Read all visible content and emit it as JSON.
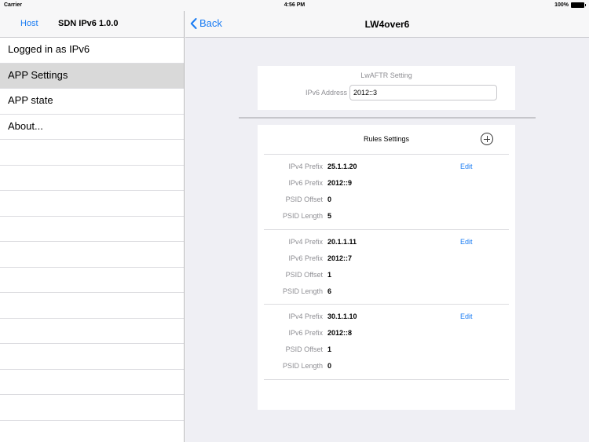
{
  "status_bar": {
    "carrier": "Carrier",
    "time": "4:56 PM",
    "battery": "100%"
  },
  "master": {
    "host_label": "Host",
    "title": "SDN IPv6 1.0.0",
    "items": [
      {
        "label": "Logged in as IPv6"
      },
      {
        "label": "APP Settings",
        "selected": true
      },
      {
        "label": "APP state"
      },
      {
        "label": "About..."
      }
    ]
  },
  "detail": {
    "back_label": "Back",
    "title": "LW4over6",
    "lwaftr": {
      "title": "LwAFTR Setting",
      "ipv6_label": "IPv6 Address",
      "ipv6_value": "2012::3"
    },
    "rules": {
      "title": "Rules Settings",
      "edit_label": "Edit",
      "labels": {
        "ipv4_prefix": "IPv4 Prefix",
        "ipv6_prefix": "IPv6 Prefix",
        "psid_offset": "PSID Offset",
        "psid_length": "PSID Length"
      },
      "items": [
        {
          "ipv4_prefix": "25.1.1.20",
          "ipv6_prefix": "2012::9",
          "psid_offset": "0",
          "psid_length": "5"
        },
        {
          "ipv4_prefix": "20.1.1.11",
          "ipv6_prefix": "2012::7",
          "psid_offset": "1",
          "psid_length": "6"
        },
        {
          "ipv4_prefix": "30.1.1.10",
          "ipv6_prefix": "2012::8",
          "psid_offset": "1",
          "psid_length": "0"
        }
      ]
    }
  },
  "colors": {
    "accent": "#1a7cf3",
    "selected_row": "#d9d9d9",
    "detail_bg": "#efeff4"
  }
}
